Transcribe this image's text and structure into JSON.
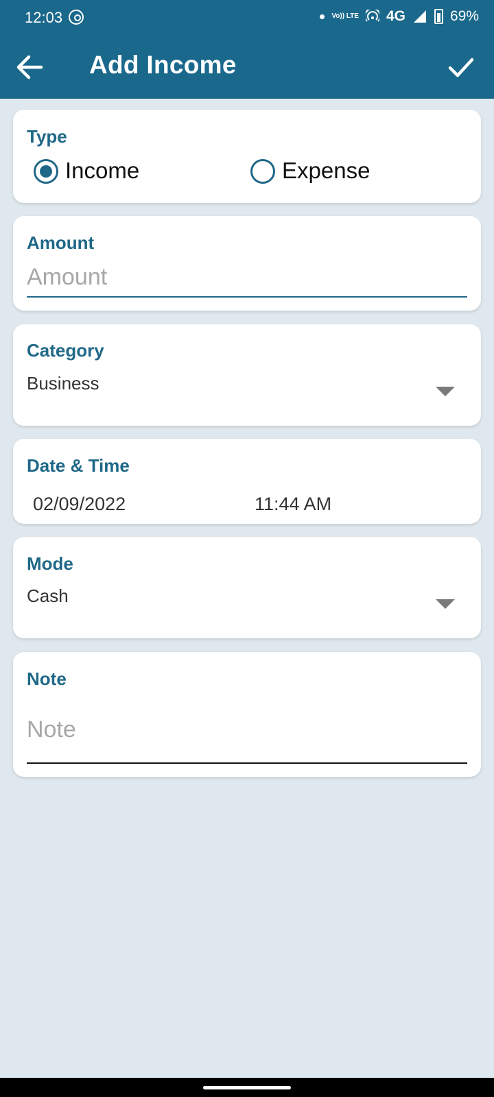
{
  "status_bar": {
    "time": "12:03",
    "volte": "Vo)) LTE",
    "network": "4G",
    "battery": "69%"
  },
  "app_bar": {
    "title": "Add Income",
    "back_icon": "arrow-left-icon",
    "save_icon": "check-icon"
  },
  "type_card": {
    "label": "Type",
    "options": [
      {
        "label": "Income",
        "selected": true
      },
      {
        "label": "Expense",
        "selected": false
      }
    ]
  },
  "amount_card": {
    "label": "Amount",
    "placeholder": "Amount",
    "value": ""
  },
  "category_card": {
    "label": "Category",
    "selected": "Business"
  },
  "datetime_card": {
    "label": "Date & Time",
    "date": "02/09/2022",
    "time": "11:44 AM"
  },
  "mode_card": {
    "label": "Mode",
    "selected": "Cash"
  },
  "note_card": {
    "label": "Note",
    "placeholder": "Note",
    "value": ""
  },
  "colors": {
    "primary": "#1a688c",
    "accent": "#1f6887",
    "background": "#dfe8ee"
  }
}
